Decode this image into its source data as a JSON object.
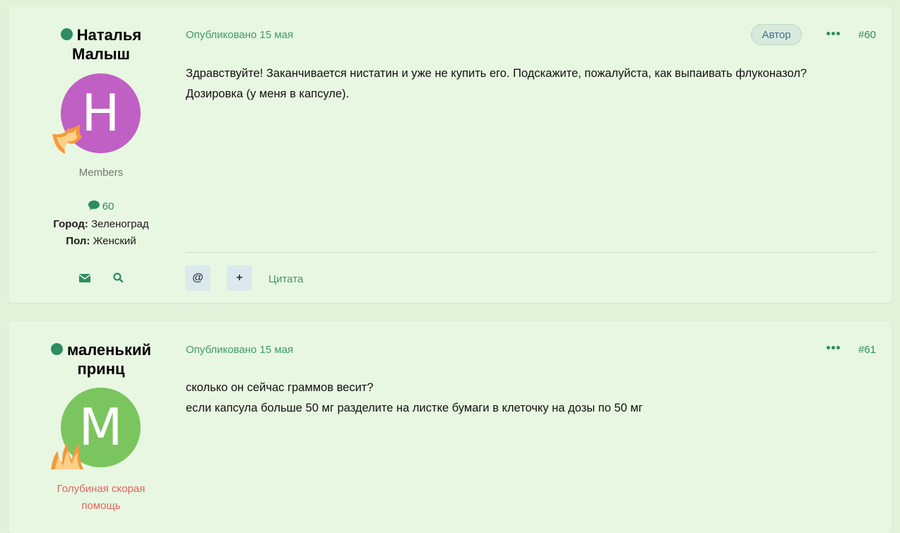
{
  "posts": [
    {
      "author_name_line1": "Наталья",
      "author_name_line2": "Малыш",
      "avatar_letter": "Н",
      "avatar_color": "#c05fc4",
      "group": "Members",
      "group_color": "#777777",
      "post_count": "60",
      "city_label": "Город:",
      "city_value": "Зеленоград",
      "gender_label": "Пол:",
      "gender_value": "Женский",
      "published": "Опубликовано 15 мая",
      "author_badge": "Автор",
      "post_number": "#60",
      "content_line1": "Здравствуйте! Заканчивается нистатин и уже не купить его. Подскажите, пожалуйста, как выпаивать флуконазол?",
      "content_line2": "Дозировка (у меня в капсуле).",
      "mention_label": "@",
      "multiquote_label": "+",
      "quote_label": "Цитата"
    },
    {
      "author_name_line1": "маленький",
      "author_name_line2": "принц",
      "avatar_letter": "М",
      "avatar_color": "#7bc55f",
      "group_line1": "Голубиная скорая",
      "group_line2": "помощь",
      "group_color": "#e0655e",
      "published": "Опубликовано 15 мая",
      "post_number": "#61",
      "content_line1": "сколько он сейчас граммов весит?",
      "content_line2": "если капсула больше 50 мг разделите на листке бумаги в клеточку на дозы по 50 мг"
    }
  ],
  "icons": {
    "online": "online-dot-icon",
    "comments": "comment-icon",
    "message": "envelope-icon",
    "search": "search-icon",
    "more": "ellipsis-icon",
    "badge": "flame-badge-icon"
  },
  "colors": {
    "accent": "#2d8c63",
    "link": "#3f9a6a",
    "post_bg": "#e8f7e1",
    "page_bg": "#e3f1da"
  }
}
